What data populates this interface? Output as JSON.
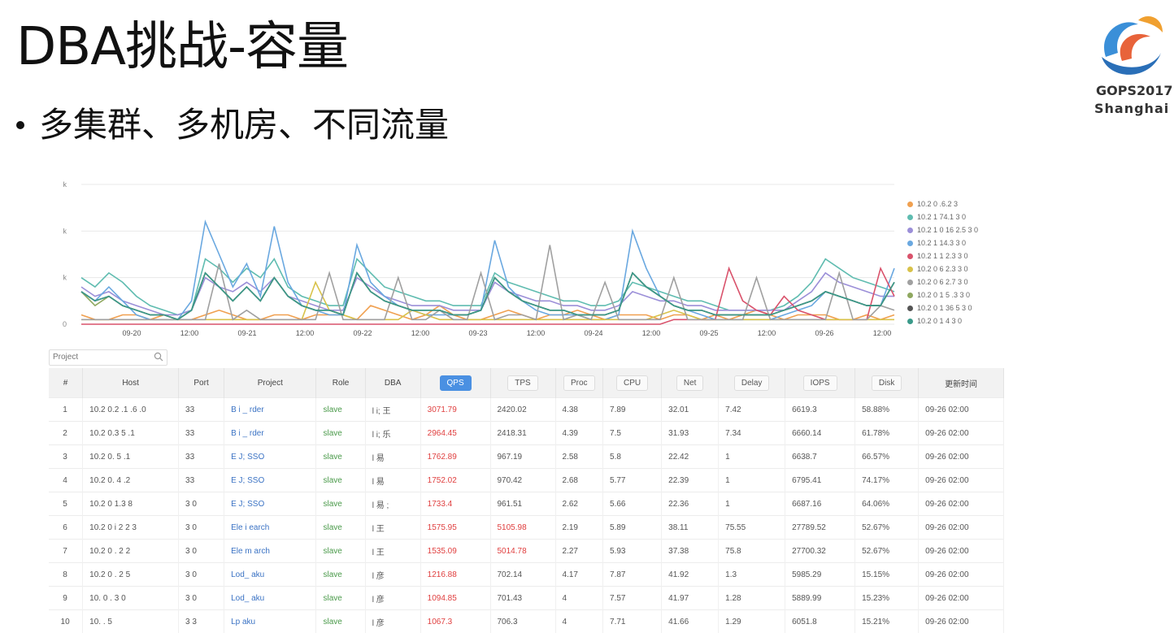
{
  "slide": {
    "title": "DBA挑战-容量",
    "bullet": "多集群、多机房、不同流量",
    "logo_line1": "GOPS2017",
    "logo_line2": "Shanghai"
  },
  "colors": {
    "accent": "#4a90e2",
    "link": "#3b73c4",
    "role": "#4a9a4a",
    "alert": "#e04040"
  },
  "search": {
    "placeholder": "Project",
    "icon": "search-icon"
  },
  "table": {
    "headers": [
      "#",
      "Host",
      "Port",
      "Project",
      "Role",
      "DBA",
      "QPS",
      "TPS",
      "Proc",
      "CPU",
      "Net",
      "Delay",
      "IOPS",
      "Disk",
      "更新时间"
    ],
    "rows": [
      [
        "1",
        "10.2 0.2 .1 .6 .0",
        "33",
        "B i _ rder",
        "slave",
        "l i; 王",
        "3071.79",
        "2420.02",
        "4.38",
        "7.89",
        "32.01",
        "7.42",
        "6619.3",
        "58.88%",
        "09-26 02:00"
      ],
      [
        "2",
        "10.2 0.3 5 .1",
        "33",
        "B i _ rder",
        "slave",
        "l i; 乐",
        "2964.45",
        "2418.31",
        "4.39",
        "7.5",
        "31.93",
        "7.34",
        "6660.14",
        "61.78%",
        "09-26 02:00"
      ],
      [
        "3",
        "10.2 0. 5 .1",
        "33",
        "E J; SSO",
        "slave",
        "l 易",
        "1762.89",
        "967.19",
        "2.58",
        "5.8",
        "22.42",
        "1",
        "6638.7",
        "66.57%",
        "09-26 02:00"
      ],
      [
        "4",
        "10.2 0. 4 .2",
        "33",
        "E J; SSO",
        "slave",
        "l 易",
        "1752.02",
        "970.42",
        "2.68",
        "5.77",
        "22.39",
        "1",
        "6795.41",
        "74.17%",
        "09-26 02:00"
      ],
      [
        "5",
        "10.2 0 1.3 8",
        "3 0",
        "E J; SSO",
        "slave",
        "l 易 ;",
        "1733.4",
        "961.51",
        "2.62",
        "5.66",
        "22.36",
        "1",
        "6687.16",
        "64.06%",
        "09-26 02:00"
      ],
      [
        "6",
        "10.2 0 i 2 2 3",
        "3 0",
        "Ele i earch",
        "slave",
        "l 王",
        "1575.95",
        "5105.98",
        "2.19",
        "5.89",
        "38.11",
        "75.55",
        "27789.52",
        "52.67%",
        "09-26 02:00"
      ],
      [
        "7",
        "10.2 0 . 2 2",
        "3 0",
        "Ele m arch",
        "slave",
        "l 王",
        "1535.09",
        "5014.78",
        "2.27",
        "5.93",
        "37.38",
        "75.8",
        "27700.32",
        "52.67%",
        "09-26 02:00"
      ],
      [
        "8",
        "10.2 0 . 2 5",
        "3 0",
        "Lod_ aku",
        "slave",
        "l 彦",
        "1216.88",
        "702.14",
        "4.17",
        "7.87",
        "41.92",
        "1.3",
        "5985.29",
        "15.15%",
        "09-26 02:00"
      ],
      [
        "9",
        "10. 0 . 3 0",
        "3 0",
        "Lod_ aku",
        "slave",
        "l 彦",
        "1094.85",
        "701.43",
        "4",
        "7.57",
        "41.97",
        "1.28",
        "5889.99",
        "15.23%",
        "09-26 02:00"
      ],
      [
        "10",
        "10. . 5",
        "3 3",
        "Lp aku",
        "slave",
        "l 彦",
        "1067.3",
        "706.3",
        "4",
        "7.71",
        "41.66",
        "1.29",
        "6051.8",
        "15.21%",
        "09-26 02:00"
      ]
    ]
  },
  "chart_data": {
    "type": "line",
    "title": "",
    "xlabel": "",
    "ylabel": "",
    "x_tick_labels": [
      "09-20",
      "12:00",
      "09-21",
      "12:00",
      "09-22",
      "12:00",
      "09-23",
      "12:00",
      "09-24",
      "12:00",
      "09-25",
      "12:00",
      "09-26",
      "12:00"
    ],
    "y_tick_labels": [
      "0",
      "k",
      "k",
      "k"
    ],
    "ylim": [
      0,
      3
    ],
    "grid": true,
    "legend_position": "right",
    "series": [
      {
        "name": "10.2 0 .6.2 3",
        "color": "#f0a050",
        "marker": "circle",
        "values": [
          0.2,
          0.1,
          0.1,
          0.2,
          0.2,
          0.1,
          0.2,
          0.1,
          0.1,
          0.2,
          0.3,
          0.2,
          0.1,
          0.1,
          0.2,
          0.2,
          0.1,
          0.2,
          0.2,
          0.2,
          0.1,
          0.4,
          0.3,
          0.2,
          0.1,
          0.2,
          0.4,
          0.2,
          0.1,
          0.1,
          0.2,
          0.3,
          0.2,
          0.1,
          0.2,
          0.2,
          0.3,
          0.2,
          0.1,
          0.2,
          0.2,
          0.2,
          0.1,
          0.2,
          0.2,
          0.1,
          0.2,
          0.1,
          0.2,
          0.3,
          0.2,
          0.1,
          0.2,
          0.2,
          0.2,
          0.1,
          0.1,
          0.2,
          0.1,
          0.2
        ]
      },
      {
        "name": "10.2 1 74.1 3 0",
        "color": "#5fbcb0",
        "marker": "cross",
        "values": [
          1.0,
          0.8,
          1.1,
          0.9,
          0.6,
          0.4,
          0.3,
          0.2,
          0.3,
          1.4,
          1.2,
          0.9,
          1.2,
          1.0,
          1.4,
          0.8,
          0.6,
          0.5,
          0.4,
          0.4,
          1.4,
          1.1,
          0.8,
          0.7,
          0.6,
          0.5,
          0.5,
          0.4,
          0.4,
          0.4,
          1.1,
          0.9,
          0.8,
          0.7,
          0.6,
          0.5,
          0.5,
          0.4,
          0.4,
          0.5,
          0.9,
          0.8,
          0.7,
          0.6,
          0.5,
          0.5,
          0.4,
          0.3,
          0.3,
          0.3,
          0.3,
          0.4,
          0.6,
          0.9,
          1.4,
          1.2,
          1.0,
          0.9,
          0.8,
          0.7
        ]
      },
      {
        "name": "10.2 1 0 16 2.5 3 0",
        "color": "#9b8fd8",
        "marker": "square",
        "values": [
          0.8,
          0.6,
          0.7,
          0.5,
          0.4,
          0.3,
          0.2,
          0.2,
          0.3,
          1.0,
          0.8,
          0.7,
          0.9,
          0.7,
          1.0,
          0.6,
          0.5,
          0.4,
          0.3,
          0.3,
          1.0,
          0.8,
          0.6,
          0.5,
          0.4,
          0.4,
          0.4,
          0.3,
          0.3,
          0.3,
          0.9,
          0.7,
          0.6,
          0.5,
          0.5,
          0.4,
          0.4,
          0.3,
          0.3,
          0.4,
          0.7,
          0.6,
          0.5,
          0.5,
          0.4,
          0.4,
          0.3,
          0.3,
          0.3,
          0.3,
          0.3,
          0.3,
          0.5,
          0.7,
          1.1,
          0.9,
          0.8,
          0.7,
          0.6,
          0.6
        ]
      },
      {
        "name": "10.2 1 14.3 3 0",
        "color": "#6aa8e0",
        "marker": "star",
        "values": [
          0.7,
          0.5,
          0.8,
          0.5,
          0.2,
          0.1,
          0.1,
          0.1,
          0.5,
          2.2,
          1.5,
          0.8,
          1.3,
          0.6,
          2.1,
          0.9,
          0.4,
          0.3,
          0.2,
          0.2,
          1.7,
          0.9,
          0.6,
          0.4,
          0.3,
          0.2,
          0.2,
          0.2,
          0.2,
          0.3,
          1.8,
          0.8,
          0.5,
          0.3,
          0.2,
          0.2,
          0.2,
          0.1,
          0.1,
          0.2,
          2.0,
          1.2,
          0.6,
          0.4,
          0.3,
          0.2,
          0.1,
          0.1,
          0.1,
          0.1,
          0.1,
          0.2,
          0.3,
          0.4,
          0.7,
          0.6,
          0.5,
          0.4,
          0.4,
          1.2
        ]
      },
      {
        "name": "10.2 1 1 2.3 3 0",
        "color": "#d9526b",
        "marker": "pin",
        "values": [
          0.0,
          0.0,
          0.0,
          0.0,
          0.0,
          0.0,
          0.0,
          0.0,
          0.0,
          0.0,
          0.0,
          0.0,
          0.0,
          0.0,
          0.0,
          0.0,
          0.0,
          0.0,
          0.0,
          0.0,
          0.0,
          0.0,
          0.0,
          0.0,
          0.0,
          0.0,
          0.0,
          0.0,
          0.0,
          0.0,
          0.0,
          0.0,
          0.0,
          0.0,
          0.0,
          0.0,
          0.0,
          0.0,
          0.0,
          0.0,
          0.0,
          0.0,
          0.0,
          0.1,
          0.1,
          0.1,
          0.1,
          1.2,
          0.5,
          0.3,
          0.2,
          0.6,
          0.3,
          0.2,
          0.1,
          0.1,
          0.1,
          0.1,
          1.2,
          0.6
        ]
      },
      {
        "name": "10.2 0 6 2.3 3 0",
        "color": "#d8c24a",
        "marker": "circle",
        "values": [
          0.1,
          0.1,
          0.1,
          0.1,
          0.1,
          0.1,
          0.1,
          0.1,
          0.1,
          0.1,
          0.1,
          0.1,
          0.1,
          0.1,
          0.1,
          0.1,
          0.1,
          0.9,
          0.3,
          0.2,
          0.1,
          0.1,
          0.1,
          0.1,
          0.3,
          0.2,
          0.1,
          0.1,
          0.1,
          0.1,
          0.1,
          0.1,
          0.1,
          0.1,
          0.1,
          0.1,
          0.1,
          0.1,
          0.1,
          0.1,
          0.1,
          0.1,
          0.2,
          0.3,
          0.2,
          0.1,
          0.1,
          0.1,
          0.1,
          0.1,
          0.1,
          0.1,
          0.1,
          0.1,
          0.1,
          0.1,
          0.1,
          0.1,
          0.1,
          0.1
        ]
      },
      {
        "name": "10.2 0 6 2.7 3 0",
        "color": "#a0a0a0",
        "marker": "diamond",
        "values": [
          0.1,
          0.1,
          0.1,
          0.1,
          0.1,
          0.1,
          0.1,
          0.1,
          0.1,
          0.1,
          1.3,
          0.1,
          0.3,
          0.1,
          0.1,
          0.1,
          0.1,
          0.1,
          1.1,
          0.1,
          0.1,
          0.1,
          0.1,
          1.0,
          0.1,
          0.1,
          0.3,
          0.1,
          0.1,
          1.1,
          0.1,
          0.2,
          0.2,
          0.1,
          1.7,
          0.1,
          0.2,
          0.1,
          0.9,
          0.1,
          0.1,
          0.1,
          0.1,
          1.0,
          0.1,
          0.1,
          0.1,
          0.1,
          0.1,
          1.0,
          0.1,
          0.1,
          0.1,
          0.1,
          0.1,
          1.1,
          0.1,
          0.1,
          0.4,
          0.3
        ]
      },
      {
        "name": "10.2 0 1 5 .3 3 0",
        "color": "#8fa860",
        "marker": "square",
        "values": [
          0.7,
          0.4,
          0.6,
          0.4,
          0.3,
          0.2,
          0.2,
          0.1,
          0.3,
          1.1,
          0.8,
          0.5,
          0.8,
          0.5,
          1.0,
          0.6,
          0.4,
          0.3,
          0.3,
          0.2,
          1.1,
          0.7,
          0.5,
          0.4,
          0.3,
          0.3,
          0.3,
          0.2,
          0.2,
          0.3,
          1.0,
          0.7,
          0.5,
          0.4,
          0.3,
          0.3,
          0.2,
          0.2,
          0.2,
          0.3,
          1.1,
          0.8,
          0.6,
          0.4,
          0.3,
          0.3,
          0.2,
          0.2,
          0.2,
          0.2,
          0.2,
          0.3,
          0.4,
          0.5,
          0.7,
          0.6,
          0.5,
          0.4,
          0.4,
          0.9
        ]
      },
      {
        "name": "10.2 0 1 36 5 3 0",
        "color": "#555555",
        "marker": "star",
        "values": [
          0.7,
          0.5,
          0.6,
          0.4,
          0.3,
          0.2,
          0.2,
          0.1,
          0.3,
          1.1,
          0.8,
          0.5,
          0.8,
          0.5,
          1.0,
          0.6,
          0.4,
          0.3,
          0.3,
          0.2,
          1.1,
          0.7,
          0.5,
          0.4,
          0.3,
          0.3,
          0.3,
          0.2,
          0.2,
          0.3,
          1.0,
          0.7,
          0.5,
          0.4,
          0.3,
          0.3,
          0.2,
          0.2,
          0.2,
          0.3,
          1.1,
          0.8,
          0.6,
          0.4,
          0.3,
          0.3,
          0.2,
          0.2,
          0.2,
          0.2,
          0.2,
          0.3,
          0.4,
          0.5,
          0.7,
          0.6,
          0.5,
          0.4,
          0.4,
          0.9
        ]
      },
      {
        "name": "10.2 0 1 4 3 0",
        "color": "#3a9a8a",
        "marker": "pin",
        "values": [
          0.7,
          0.5,
          0.6,
          0.4,
          0.3,
          0.2,
          0.2,
          0.1,
          0.3,
          1.1,
          0.8,
          0.5,
          0.8,
          0.5,
          1.0,
          0.6,
          0.4,
          0.3,
          0.3,
          0.2,
          1.1,
          0.7,
          0.5,
          0.4,
          0.3,
          0.3,
          0.3,
          0.2,
          0.2,
          0.3,
          1.0,
          0.7,
          0.5,
          0.4,
          0.3,
          0.3,
          0.2,
          0.2,
          0.2,
          0.3,
          1.1,
          0.8,
          0.6,
          0.4,
          0.3,
          0.3,
          0.2,
          0.2,
          0.2,
          0.2,
          0.2,
          0.3,
          0.4,
          0.5,
          0.7,
          0.6,
          0.5,
          0.4,
          0.4,
          0.9
        ]
      }
    ]
  }
}
